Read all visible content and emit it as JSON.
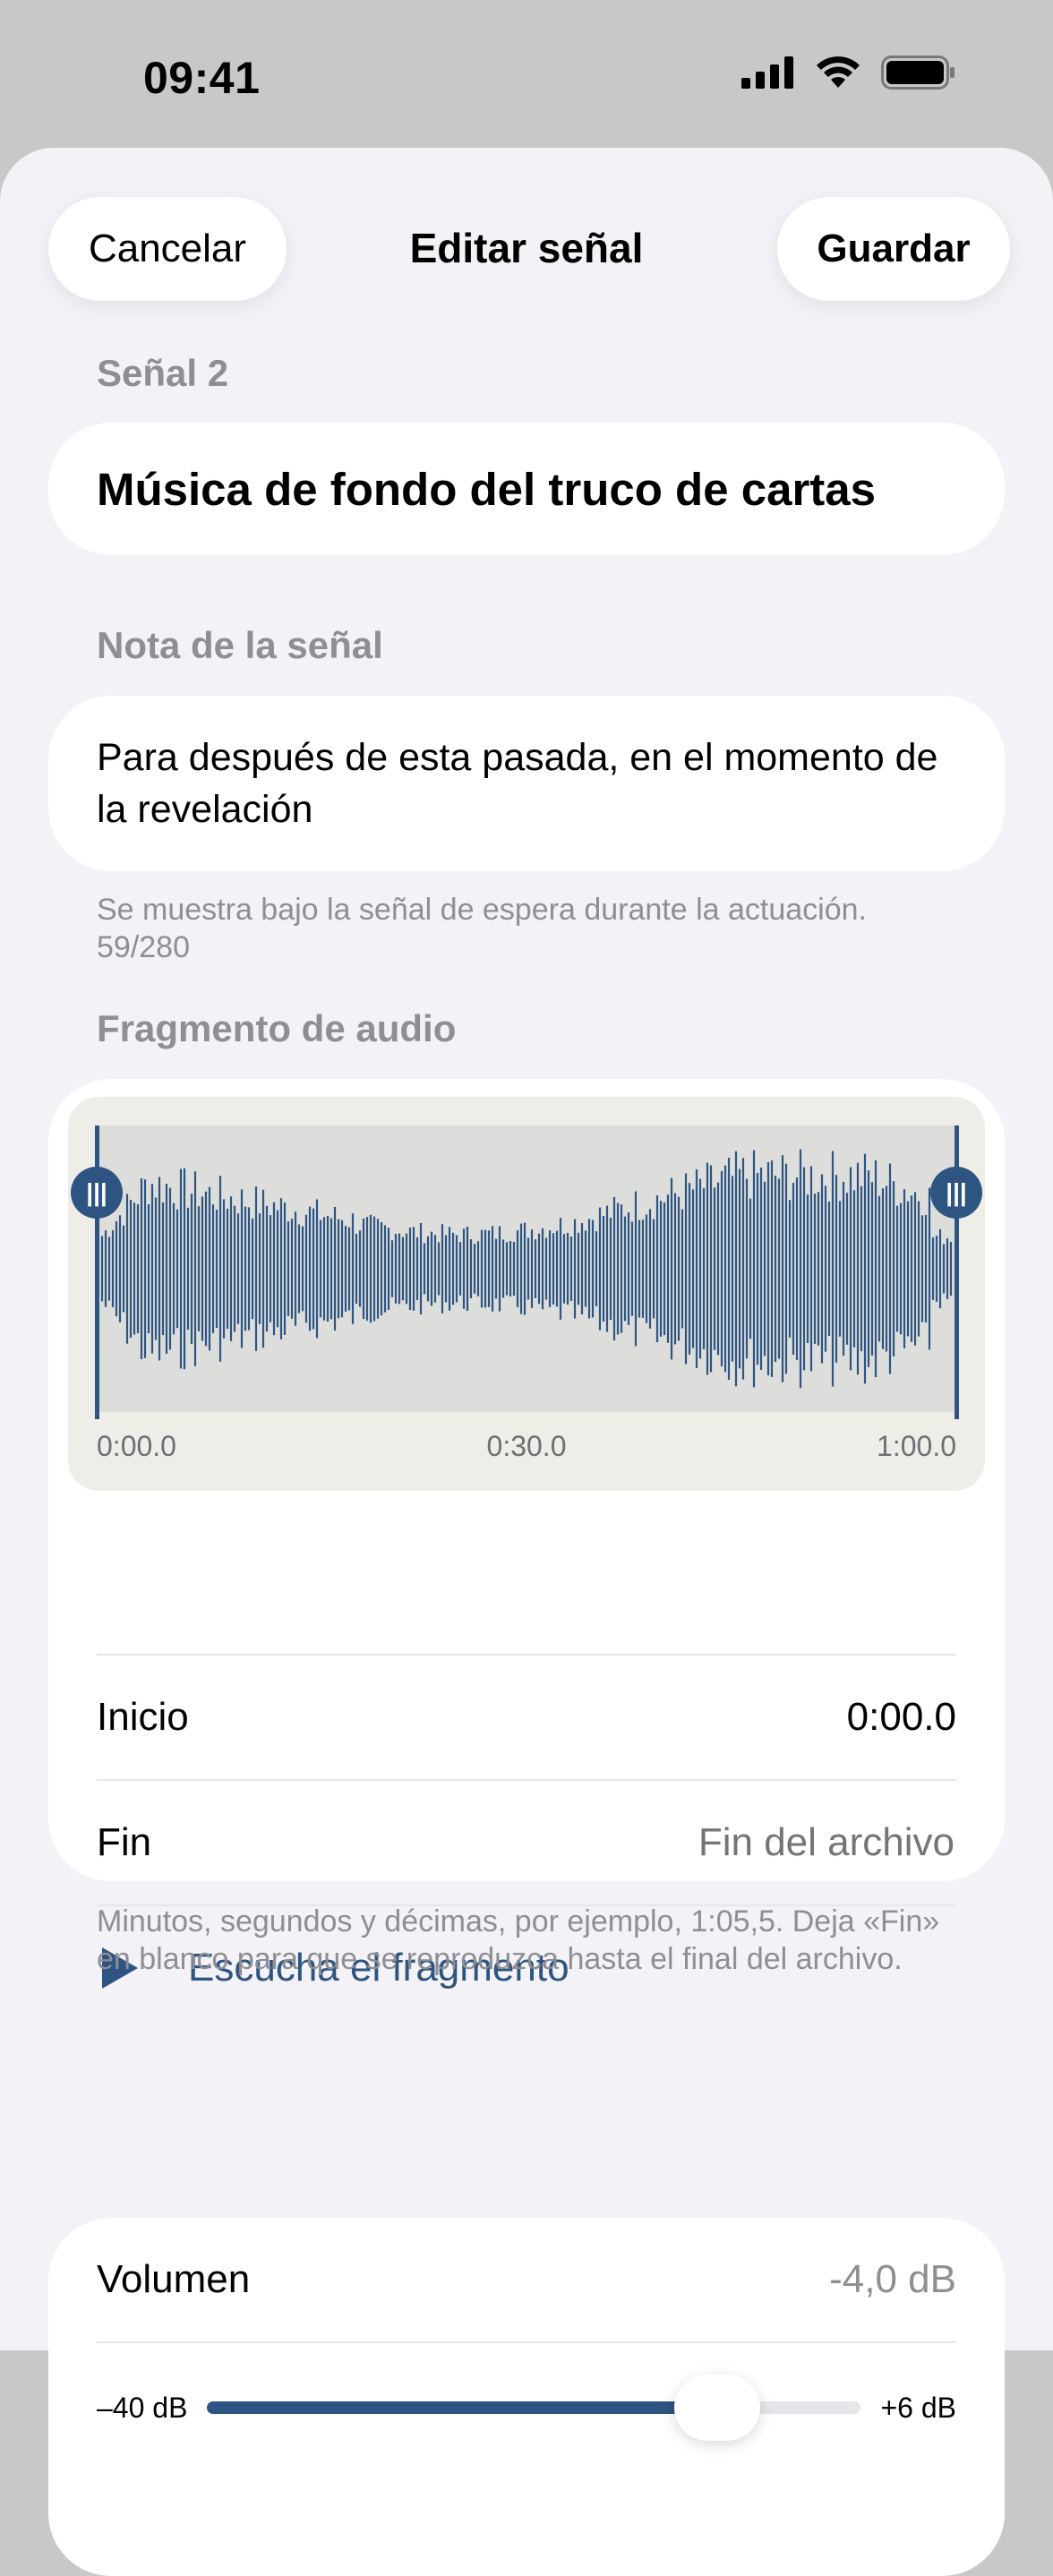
{
  "status_bar": {
    "time": "09:41"
  },
  "nav": {
    "cancel_label": "Cancelar",
    "title": "Editar señal",
    "save_label": "Guardar"
  },
  "cue": {
    "section_label": "Señal 2",
    "title": "Música de fondo del truco de cartas"
  },
  "note": {
    "section_label": "Nota de la señal",
    "text": "Para después de esta pasada, en el momento de la revelación",
    "hint": "Se muestra bajo la señal de espera durante la actuación.",
    "counter": "59/280"
  },
  "audio": {
    "section_label": "Fragmento de audio",
    "handle_glyph": "|||",
    "ticks": [
      "0:00.0",
      "0:30.0",
      "1:00.0"
    ],
    "start_label": "Inicio",
    "start_value": "0:00.0",
    "end_label": "Fin",
    "end_placeholder": "Fin del archivo",
    "listen_label": "Escucha el fragmento",
    "hint": "Minutos, segundos y décimas, por ejemplo, 1:05,5. Deja «Fin» en blanco para que se reproduzca hasta el final del archivo."
  },
  "volume": {
    "label": "Volumen",
    "value": "-4,0 dB",
    "min_label": "–40 dB",
    "max_label": "+6 dB",
    "level_fraction": 0.78
  },
  "colors": {
    "accent": "#2e5482",
    "background": "#f2f2f7",
    "secondary_text": "#8e8e93"
  },
  "icons": {
    "play": "play-icon",
    "signal": "cellular-signal-icon",
    "wifi": "wifi-icon",
    "battery": "battery-icon"
  }
}
